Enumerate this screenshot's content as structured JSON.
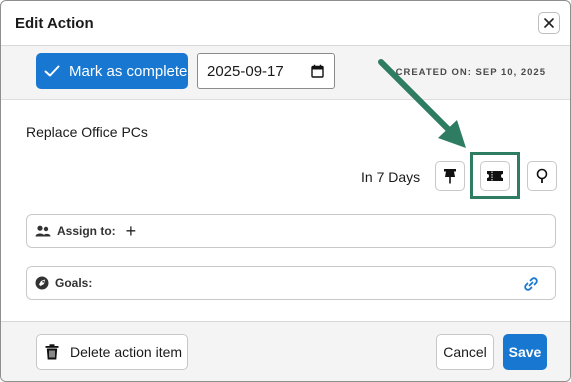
{
  "dialog": {
    "title": "Edit Action",
    "close_icon": "close-icon"
  },
  "toolbar": {
    "complete_label": "Mark as complete",
    "complete_icon": "check-icon",
    "date_value": "2025-09-17",
    "date_icon": "calendar-icon",
    "created_text": "CREATED ON: SEP 10, 2025"
  },
  "action": {
    "title": "Replace Office PCs",
    "due_text": "In 7 Days",
    "buttons": {
      "pin_icon": "pin-icon",
      "ticket_icon": "ticket-icon",
      "location_icon": "location-pin-icon"
    }
  },
  "fields": {
    "assign_label": "Assign to:",
    "assign_icon": "users-icon",
    "assign_add": "+",
    "goals_label": "Goals:",
    "goals_icon": "rocket-icon",
    "goals_link_icon": "link-icon"
  },
  "footer": {
    "delete_label": "Delete action item",
    "delete_icon": "trash-icon",
    "cancel_label": "Cancel",
    "save_label": "Save"
  },
  "colors": {
    "primary": "#1777d1",
    "annotation": "#2e7c62"
  }
}
